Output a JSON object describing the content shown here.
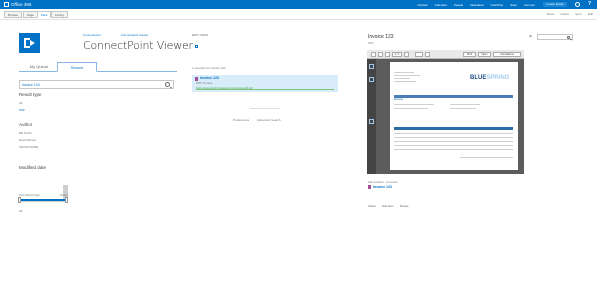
{
  "suitebar": {
    "app_name": "Office 365",
    "nav": [
      "Outlook",
      "Calendar",
      "People",
      "Newsfeed",
      "OneDrive",
      "Sites",
      "Yammer"
    ],
    "user": "Lorem Ipsum",
    "help": "?"
  },
  "ribbon": {
    "tabs": [
      "Browse",
      "Page",
      "Files",
      "Library"
    ],
    "actions": [
      "Share",
      "Follow",
      "Sync",
      "Edit"
    ]
  },
  "header": {
    "breadcrumb": [
      "Connectpoint",
      "Connectpoint Viewer"
    ],
    "edit_links": "EDIT LINKS",
    "title": "ConnectPoint Viewer"
  },
  "left": {
    "tabs": [
      "My Queue",
      "Search"
    ],
    "search_value": "invoice 123",
    "result_type_heading": "Result type",
    "result_type_items": [
      "All",
      "PDF"
    ],
    "author_heading": "Author",
    "author_items": [
      "Bill Smith",
      "David Brown",
      "SHOW MORE"
    ],
    "modified_heading": "Modified date",
    "date_from": "One Month Ago",
    "date_to": "Today",
    "date_all": "All",
    "histogram": [
      0.15,
      0.15,
      0.15,
      0.15,
      0.15,
      0.15,
      0.15,
      0.15,
      1.0
    ]
  },
  "results": {
    "count_text": "1 result(s) for invoice 123",
    "item_title": "Invoice 123",
    "item_meta": "PDF Invoice",
    "item_url": "https://connectpoint.sharepoint.com/invoice123.pdf",
    "paging": [
      "Preferences",
      "Advanced Search"
    ]
  },
  "preview": {
    "title": "Invoice 123",
    "subtitle": "PDF",
    "close": "×",
    "toolbar": [
      "Print",
      "Open",
      "Annotations"
    ],
    "page_field": "1 / 1",
    "invoice_logo": "BLUE",
    "invoice_logo_suffix": "SPRING",
    "invoice_heading": "INVOICE",
    "file_label": "File location - Invoices",
    "file_link": "Invoice 123",
    "actions": [
      "Share",
      "Edit Item",
      "Delete"
    ]
  }
}
